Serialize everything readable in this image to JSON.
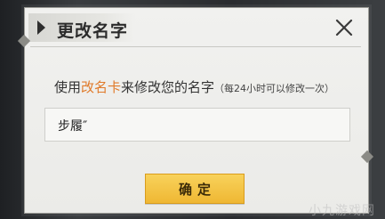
{
  "dialog": {
    "title": "更改名字",
    "close_icon": "close-icon"
  },
  "prompt": {
    "part1": "使用",
    "highlight": "改名卡",
    "part2": "来修改您的名字",
    "note": "（每24小时可以修改一次）",
    "highlight_color": "#e07a2a"
  },
  "name_field": {
    "value": "步履″"
  },
  "confirm": {
    "label": "确定",
    "color": "#f3c244"
  },
  "watermark": "小九游戏网"
}
